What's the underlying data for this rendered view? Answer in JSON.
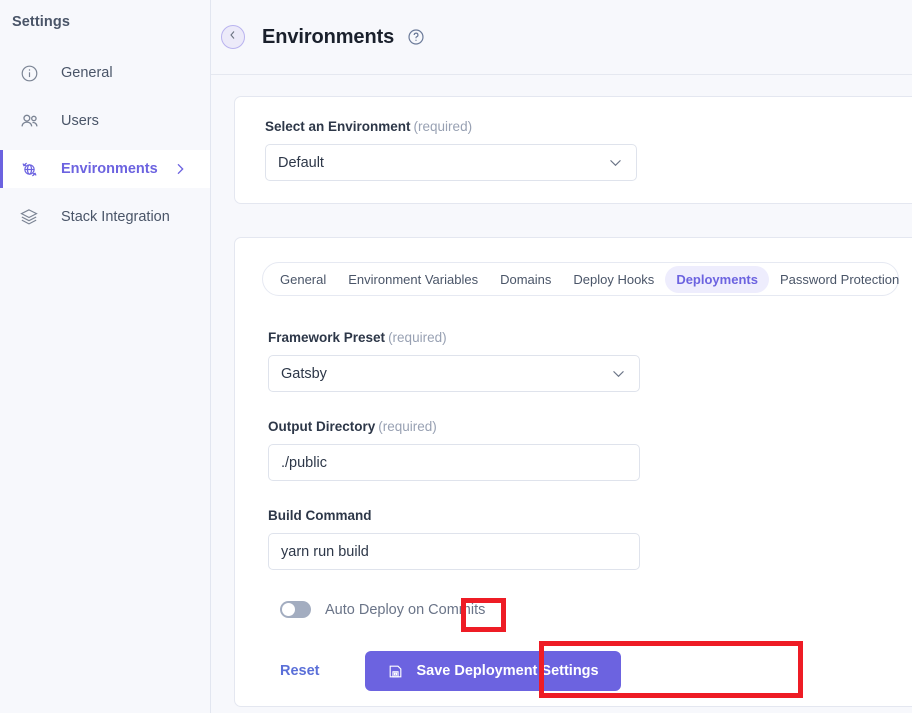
{
  "sidebar": {
    "title": "Settings",
    "items": [
      {
        "label": "General",
        "icon": "info-circle-icon"
      },
      {
        "label": "Users",
        "icon": "users-icon"
      },
      {
        "label": "Environments",
        "icon": "environment-globe-icon",
        "active": true
      },
      {
        "label": "Stack Integration",
        "icon": "layers-icon"
      }
    ]
  },
  "header": {
    "back_icon": "chevron-left-icon",
    "title": "Environments",
    "help_icon": "help-circle-icon"
  },
  "environment_card": {
    "label": "Select an Environment",
    "required_hint": "(required)",
    "selected": "Default",
    "chevron_icon": "chevron-down-icon"
  },
  "tabs": [
    {
      "label": "General",
      "active": false
    },
    {
      "label": "Environment Variables",
      "active": false
    },
    {
      "label": "Domains",
      "active": false
    },
    {
      "label": "Deploy Hooks",
      "active": false
    },
    {
      "label": "Deployments",
      "active": true
    },
    {
      "label": "Password Protection",
      "active": false
    }
  ],
  "form": {
    "framework_preset": {
      "label": "Framework Preset",
      "required_hint": "(required)",
      "value": "Gatsby",
      "chevron_icon": "chevron-down-icon"
    },
    "output_directory": {
      "label": "Output Directory",
      "required_hint": "(required)",
      "value": "./public",
      "placeholder": "./public"
    },
    "build_command": {
      "label": "Build Command",
      "required_hint": "",
      "value": "yarn run build",
      "placeholder": "yarn run build"
    },
    "auto_deploy": {
      "label": "Auto Deploy on Commits",
      "enabled": false
    },
    "reset_label": "Reset",
    "save_label": "Save Deployment Settings",
    "save_icon": "floppy-disk-icon"
  },
  "colors": {
    "accent": "#6c63e0",
    "accent_soft": "#eeedfd",
    "annotation": "#ee1c25",
    "page_bg": "#f7f8fc",
    "card_bg": "#ffffff",
    "text": "#2d3748",
    "muted": "#98a1b3"
  }
}
